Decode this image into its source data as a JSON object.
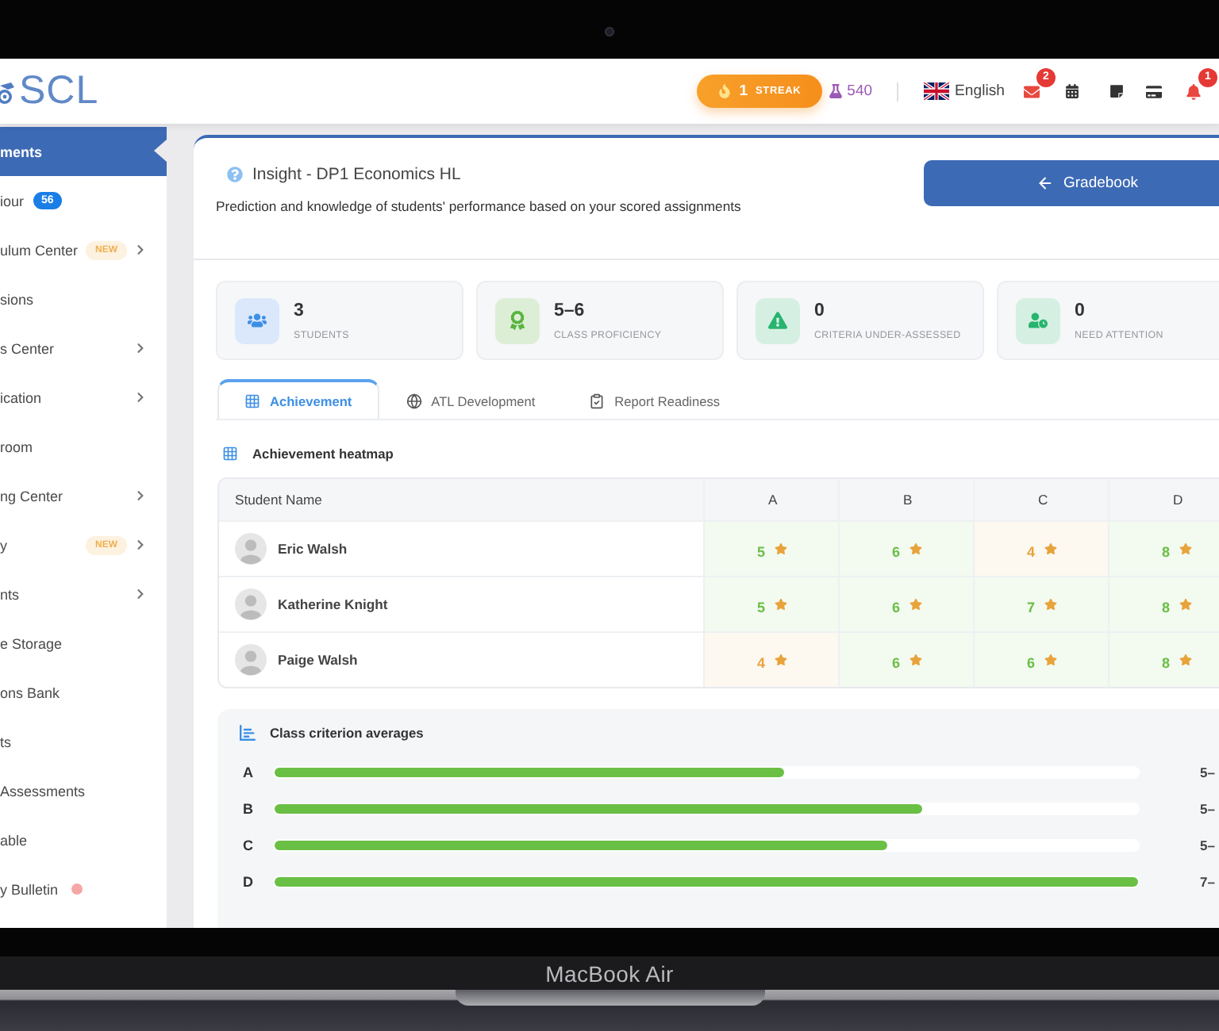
{
  "device": {
    "model": "MacBook Air"
  },
  "topbar": {
    "logo": "SCL",
    "streak": {
      "count": "1",
      "label": "STREAK"
    },
    "points": "540",
    "language": "English",
    "actions": [
      {
        "kind": "mail",
        "badge": "2"
      },
      {
        "kind": "calendar"
      },
      {
        "kind": "note"
      },
      {
        "kind": "card"
      },
      {
        "kind": "bell",
        "badge": "1"
      }
    ]
  },
  "sidebar": {
    "items": [
      {
        "label": "ments",
        "selected": true,
        "submenu": false,
        "unread": false
      },
      {
        "label": "iour",
        "count": "56",
        "selected": false,
        "submenu": false,
        "unread": false
      },
      {
        "label": "ulum Center",
        "tag": "NEW",
        "selected": false,
        "submenu": true,
        "unread": false
      },
      {
        "label": "sions",
        "selected": false,
        "submenu": false,
        "unread": false
      },
      {
        "label": "s Center",
        "selected": false,
        "submenu": true,
        "unread": false
      },
      {
        "label": "ication",
        "selected": false,
        "submenu": true,
        "unread": false
      },
      {
        "label": "room",
        "selected": false,
        "submenu": false,
        "unread": false
      },
      {
        "label": "ng Center",
        "selected": false,
        "submenu": true,
        "unread": false
      },
      {
        "label": "y",
        "tag": "NEW",
        "selected": false,
        "submenu": true,
        "unread": false
      },
      {
        "label": "nts",
        "selected": false,
        "submenu": true,
        "unread": false
      },
      {
        "label": "e Storage",
        "selected": false,
        "submenu": false,
        "unread": false
      },
      {
        "label": "ons Bank",
        "selected": false,
        "submenu": false,
        "unread": false
      },
      {
        "label": "ts",
        "selected": false,
        "submenu": false,
        "unread": false
      },
      {
        "label": "Assessments",
        "selected": false,
        "submenu": false,
        "unread": false
      },
      {
        "label": "able",
        "selected": false,
        "submenu": false,
        "unread": false
      },
      {
        "label": "y Bulletin",
        "selected": false,
        "submenu": false,
        "unread": true
      }
    ]
  },
  "header": {
    "title": "Insight - DP1 Economics HL",
    "subtitle": "Prediction and knowledge of students' performance based on your scored assignments",
    "button": "Gradebook"
  },
  "stats": [
    {
      "kind": "students",
      "value": "3",
      "label": "STUDENTS"
    },
    {
      "kind": "proficiency",
      "value": "5–6",
      "label": "CLASS PROFICIENCY"
    },
    {
      "kind": "under_assessed",
      "value": "0",
      "label": "CRITERIA UNDER-ASSESSED"
    },
    {
      "kind": "attention",
      "value": "0",
      "label": "NEED ATTENTION"
    }
  ],
  "tabs": [
    {
      "kind": "grid",
      "label": "Achievement",
      "selected": true
    },
    {
      "kind": "globe",
      "label": "ATL Development",
      "selected": false
    },
    {
      "kind": "clipboard",
      "label": "Report Readiness",
      "selected": false
    }
  ],
  "heatmap": {
    "title": "Achievement heatmap",
    "columns": [
      "Student Name",
      "A",
      "B",
      "C",
      "D"
    ],
    "rows": [
      {
        "name": "Eric Walsh",
        "scores": [
          {
            "value": "5",
            "color": "#6abf45"
          },
          {
            "value": "6",
            "color": "#6abf45"
          },
          {
            "value": "4",
            "color": "#e8a33a"
          },
          {
            "value": "8",
            "color": "#6abf45"
          }
        ]
      },
      {
        "name": "Katherine Knight",
        "scores": [
          {
            "value": "5",
            "color": "#6abf45"
          },
          {
            "value": "6",
            "color": "#6abf45"
          },
          {
            "value": "7",
            "color": "#6abf45"
          },
          {
            "value": "8",
            "color": "#6abf45"
          }
        ]
      },
      {
        "name": "Paige Walsh",
        "scores": [
          {
            "value": "4",
            "color": "#e8a33a"
          },
          {
            "value": "6",
            "color": "#6abf45"
          },
          {
            "value": "6",
            "color": "#6abf45"
          },
          {
            "value": "8",
            "color": "#6abf45"
          }
        ]
      }
    ]
  },
  "averages": {
    "title": "Class criterion averages",
    "rows": [
      {
        "label": "A",
        "level": 0.59,
        "reading": "5–"
      },
      {
        "label": "B",
        "level": 0.75,
        "reading": "5–"
      },
      {
        "label": "C",
        "level": 0.71,
        "reading": "5–"
      },
      {
        "label": "D",
        "level": 1,
        "reading": "7–"
      }
    ]
  }
}
